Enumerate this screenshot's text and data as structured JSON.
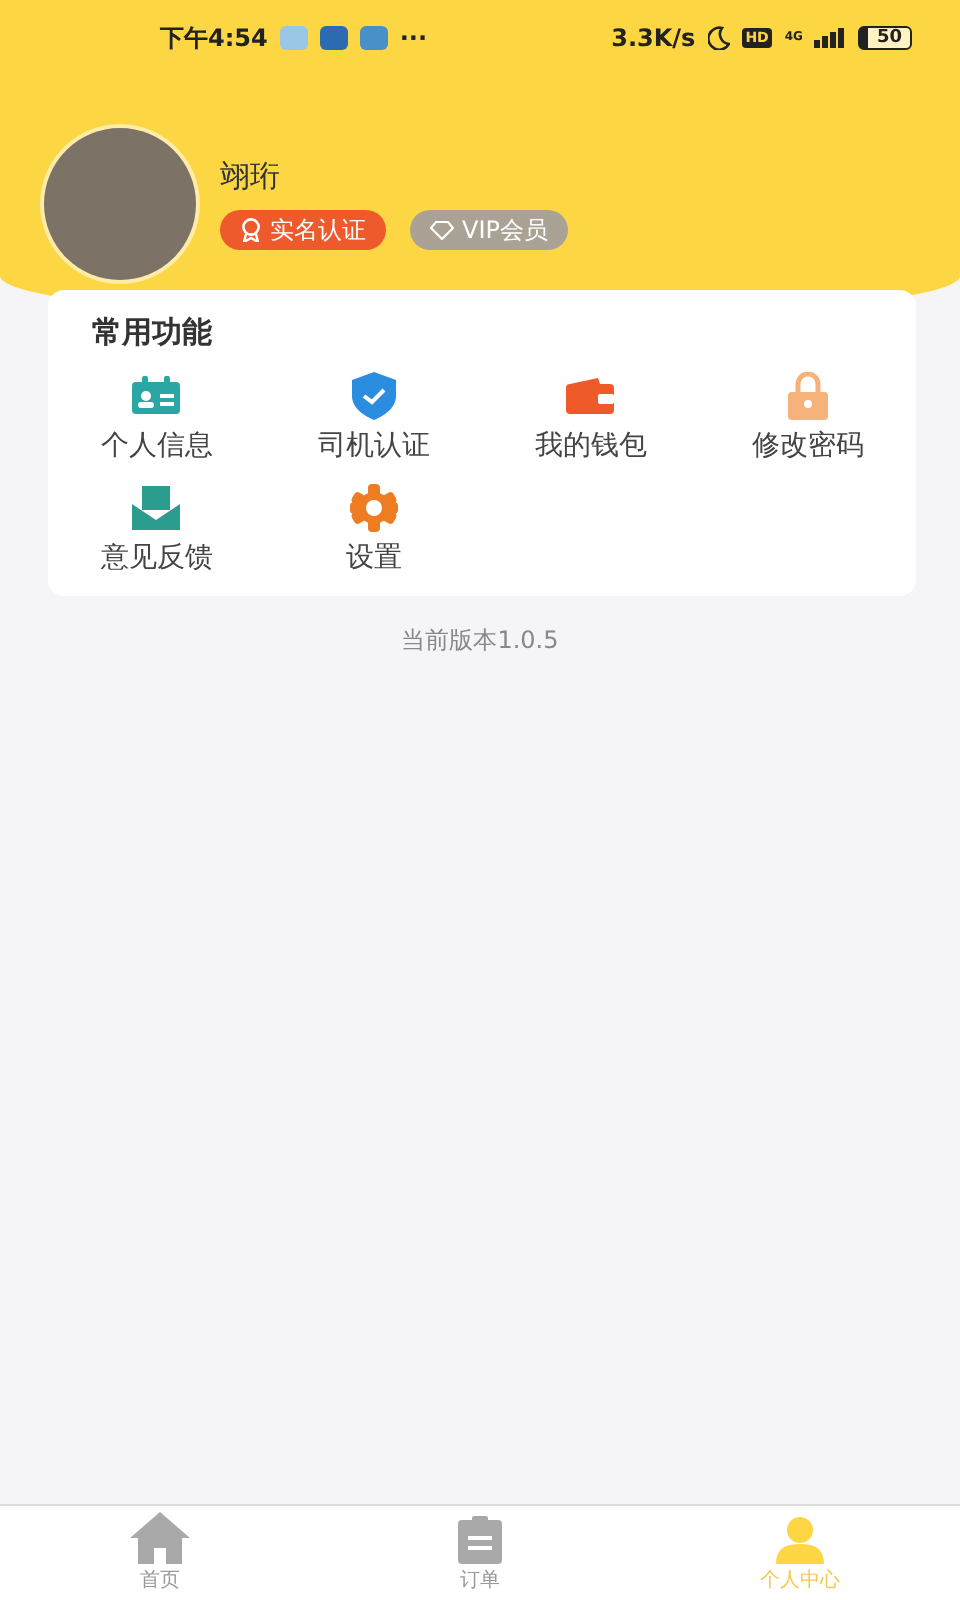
{
  "status_bar": {
    "time": "下午4:54",
    "overflow": "···",
    "network_speed": "3.3K/s",
    "hd_label": "HD",
    "network_type": "4G",
    "battery": "50"
  },
  "profile": {
    "name": "翊珩",
    "badges": [
      {
        "label": "实名认证",
        "kind": "verified"
      },
      {
        "label": "VIP会员",
        "kind": "vip"
      }
    ]
  },
  "functions": {
    "title": "常用功能",
    "items": [
      {
        "label": "个人信息",
        "kind": "idcard"
      },
      {
        "label": "司机认证",
        "kind": "shield"
      },
      {
        "label": "我的钱包",
        "kind": "wallet"
      },
      {
        "label": "修改密码",
        "kind": "lock"
      },
      {
        "label": "意见反馈",
        "kind": "mail"
      },
      {
        "label": "设置",
        "kind": "gear"
      }
    ]
  },
  "version": "当前版本1.0.5",
  "tab_bar": [
    {
      "label": "首页",
      "kind": "home",
      "selected": false
    },
    {
      "label": "订单",
      "kind": "order",
      "selected": false
    },
    {
      "label": "个人中心",
      "kind": "user",
      "selected": true
    }
  ]
}
